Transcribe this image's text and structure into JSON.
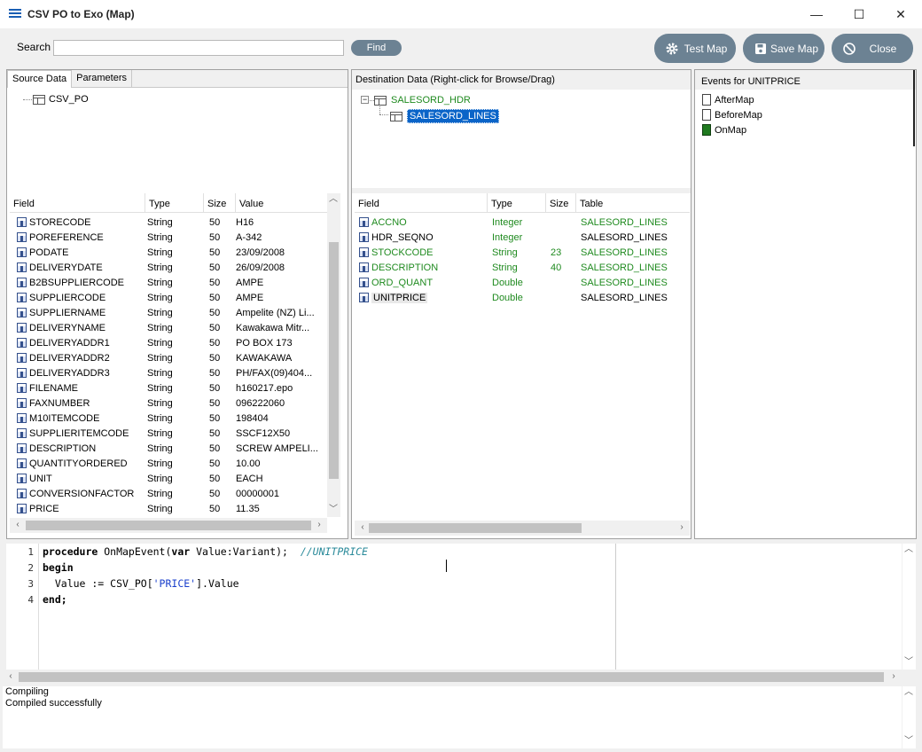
{
  "window": {
    "title": "CSV PO to Exo (Map)",
    "minimize": "—",
    "maximize": "☐",
    "close": "✕"
  },
  "toolbar": {
    "search_label": "Search",
    "search_value": "",
    "find_label": "Find",
    "test_map_label": "Test Map",
    "save_map_label": "Save Map",
    "close_label": "Close"
  },
  "source": {
    "tabs": [
      "Source Data",
      "Parameters"
    ],
    "tree_root": "CSV_PO",
    "columns": [
      "Field",
      "Type",
      "Size",
      "Value"
    ],
    "rows": [
      {
        "field": "STORECODE",
        "type": "String",
        "size": "50",
        "value": "H16"
      },
      {
        "field": "POREFERENCE",
        "type": "String",
        "size": "50",
        "value": "A-342"
      },
      {
        "field": "PODATE",
        "type": "String",
        "size": "50",
        "value": "23/09/2008"
      },
      {
        "field": "DELIVERYDATE",
        "type": "String",
        "size": "50",
        "value": "26/09/2008"
      },
      {
        "field": "B2BSUPPLIERCODE",
        "type": "String",
        "size": "50",
        "value": "AMPE"
      },
      {
        "field": "SUPPLIERCODE",
        "type": "String",
        "size": "50",
        "value": "AMPE"
      },
      {
        "field": "SUPPLIERNAME",
        "type": "String",
        "size": "50",
        "value": "Ampelite (NZ) Li..."
      },
      {
        "field": "DELIVERYNAME",
        "type": "String",
        "size": "50",
        "value": "Kawakawa Mitr..."
      },
      {
        "field": "DELIVERYADDR1",
        "type": "String",
        "size": "50",
        "value": "PO BOX 173"
      },
      {
        "field": "DELIVERYADDR2",
        "type": "String",
        "size": "50",
        "value": "KAWAKAWA"
      },
      {
        "field": "DELIVERYADDR3",
        "type": "String",
        "size": "50",
        "value": "PH/FAX(09)404..."
      },
      {
        "field": "FILENAME",
        "type": "String",
        "size": "50",
        "value": "h160217.epo"
      },
      {
        "field": "FAXNUMBER",
        "type": "String",
        "size": "50",
        "value": "096222060"
      },
      {
        "field": "M10ITEMCODE",
        "type": "String",
        "size": "50",
        "value": "198404"
      },
      {
        "field": "SUPPLIERITEMCODE",
        "type": "String",
        "size": "50",
        "value": "SSCF12X50"
      },
      {
        "field": "DESCRIPTION",
        "type": "String",
        "size": "50",
        "value": "SCREW AMPELI..."
      },
      {
        "field": "QUANTITYORDERED",
        "type": "String",
        "size": "50",
        "value": "10.00"
      },
      {
        "field": "UNIT",
        "type": "String",
        "size": "50",
        "value": "EACH"
      },
      {
        "field": "CONVERSIONFACTOR",
        "type": "String",
        "size": "50",
        "value": "00000001"
      },
      {
        "field": "PRICE",
        "type": "String",
        "size": "50",
        "value": "11.35"
      }
    ]
  },
  "destination": {
    "header": "Destination Data  (Right-click for Browse/Drag)",
    "tree_root": "SALESORD_HDR",
    "tree_child": "SALESORD_LINES",
    "columns": [
      "Field",
      "Type",
      "Size",
      "Table"
    ],
    "rows": [
      {
        "field": "ACCNO",
        "type": "Integer",
        "size": "",
        "table": "SALESORD_LINES",
        "mapped": true
      },
      {
        "field": "HDR_SEQNO",
        "type": "Integer",
        "size": "",
        "table": "SALESORD_LINES",
        "mapped": false
      },
      {
        "field": "STOCKCODE",
        "type": "String",
        "size": "23",
        "table": "SALESORD_LINES",
        "mapped": true
      },
      {
        "field": "DESCRIPTION",
        "type": "String",
        "size": "40",
        "table": "SALESORD_LINES",
        "mapped": true
      },
      {
        "field": "ORD_QUANT",
        "type": "Double",
        "size": "",
        "table": "SALESORD_LINES",
        "mapped": true
      },
      {
        "field": "UNITPRICE",
        "type": "Double",
        "size": "",
        "table": "SALESORD_LINES",
        "mapped": false
      }
    ]
  },
  "events": {
    "header": "Events for UNITPRICE",
    "items": [
      "AfterMap",
      "BeforeMap",
      "OnMap"
    ]
  },
  "code": {
    "line_numbers": [
      "1",
      "2",
      "3",
      "4"
    ],
    "l1_kw": "procedure",
    "l1_name": " OnMapEvent(",
    "l1_kw2": "var",
    "l1_rest": " Value:Variant);  ",
    "l1_comment": "//UNITPRICE",
    "l2": "begin",
    "l3_a": "  Value := CSV_PO[",
    "l3_str": "'PRICE'",
    "l3_b": "].Value",
    "l4": "end;"
  },
  "log": {
    "lines": [
      "Compiling",
      "Compiled successfully"
    ]
  }
}
